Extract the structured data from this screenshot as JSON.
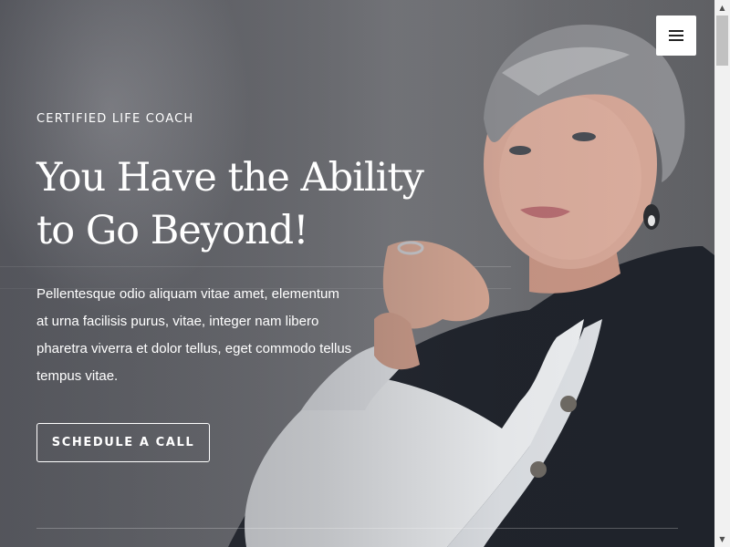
{
  "hero": {
    "eyebrow": "CERTIFIED LIFE COACH",
    "headline_line1": "You Have the Ability",
    "headline_line2": "to Go Beyond!",
    "lead_line1": "Pellentesque odio aliquam vitae amet, elementum",
    "lead_line2": "at urna facilisis purus, vitae, integer nam libero",
    "lead_line3": "pharetra viverra et dolor tellus, eget commodo tellus",
    "lead_line4": "tempus vitae.",
    "cta_label": "SCHEDULE A CALL",
    "image_subject": "portrait-of-woman-in-dark-blazer"
  },
  "header": {
    "menu_icon": "hamburger-icon"
  },
  "scrollbar": {
    "up_glyph": "▲",
    "down_glyph": "▼"
  },
  "colors": {
    "text": "#ffffff",
    "menu_button_bg": "#ffffff",
    "menu_icon": "#222222",
    "blazer": "#1f232b",
    "blouse": "#eef0f2"
  }
}
